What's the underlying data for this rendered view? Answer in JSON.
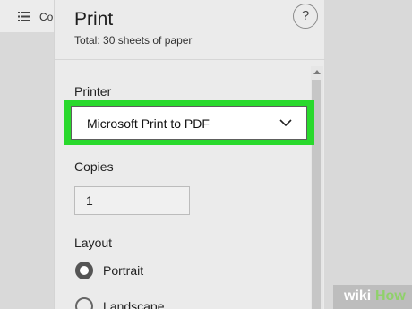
{
  "background": {
    "partial_text": "Co",
    "list_icon": "list-icon"
  },
  "print_panel": {
    "title": "Print",
    "subtitle": "Total: 30 sheets of paper",
    "help_label": "?",
    "printer": {
      "label": "Printer",
      "selected": "Microsoft Print to PDF",
      "dropdown_icon": "chevron-down-icon",
      "highlight_color": "#29d92c"
    },
    "copies": {
      "label": "Copies",
      "value": "1"
    },
    "layout": {
      "label": "Layout",
      "options": [
        {
          "label": "Portrait",
          "checked": true
        },
        {
          "label": "Landscape",
          "checked": false
        }
      ]
    }
  },
  "watermark": {
    "part1": "wiki",
    "part2": "How"
  }
}
